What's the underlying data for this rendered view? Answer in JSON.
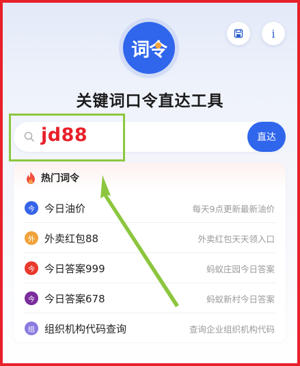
{
  "header": {
    "logo_text": "词令",
    "title": "关键词口令直达工具",
    "save_icon": "save-icon",
    "info_label": "i"
  },
  "search": {
    "value": "jd88",
    "go_label": "直达"
  },
  "hot": {
    "title": "热门词令",
    "items": [
      {
        "badge": "今",
        "label": "今日油价",
        "desc": "每天9点更新最新油价",
        "color": "#3563e9"
      },
      {
        "badge": "外",
        "label": "外卖红包88",
        "desc": "外卖红包天天领入口",
        "color": "#f0a23a"
      },
      {
        "badge": "今",
        "label": "今日答案999",
        "desc": "蚂蚁庄园今日答案",
        "color": "#e8392c"
      },
      {
        "badge": "今",
        "label": "今日答案678",
        "desc": "蚂蚁新村今日答案",
        "color": "#7a2d9c"
      },
      {
        "badge": "组",
        "label": "组织机构代码查询",
        "desc": "查询企业组织机构代码",
        "color": "#8a7be0"
      }
    ]
  },
  "colors": {
    "frame": "#e8202a",
    "accent": "#2f66ec",
    "highlight": "#8cc63f"
  }
}
